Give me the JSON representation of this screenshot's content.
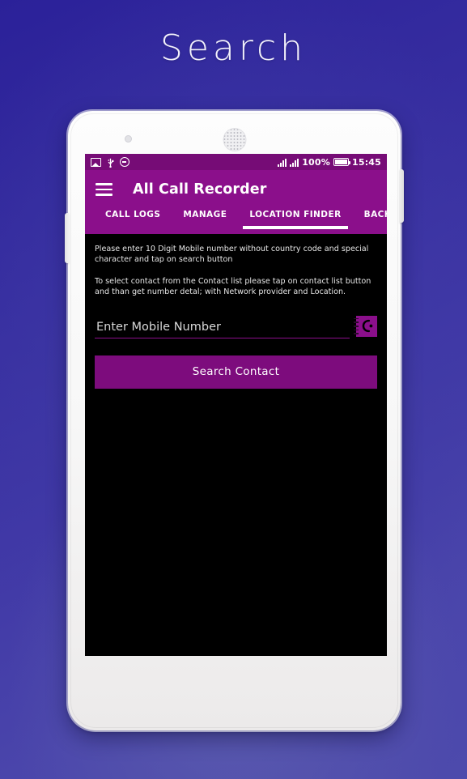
{
  "page": {
    "title": "Search"
  },
  "phone": {
    "hardware": {
      "front_camera": "front-camera",
      "earpiece": "earpiece-speaker",
      "power_button": "power-button",
      "volume_button": "volume-button"
    }
  },
  "status_bar": {
    "icons_left": [
      "photo-icon",
      "usb-icon",
      "smiley-icon"
    ],
    "icons_right": [
      "signal-icon",
      "signal-icon",
      "battery-icon"
    ],
    "battery_percent": "100%",
    "time": "15:45"
  },
  "app_bar": {
    "menu_icon": "hamburger-menu-icon",
    "title": "All Call Recorder"
  },
  "tabs": [
    {
      "label": "CALL LOGS",
      "active": false
    },
    {
      "label": "MANAGE",
      "active": false
    },
    {
      "label": "LOCATION FINDER",
      "active": true
    },
    {
      "label": "BACKUP",
      "active": false
    }
  ],
  "content": {
    "hint_1": "Please enter 10 Digit Mobile number without country code and special character and tap on search button",
    "hint_2": " To select contact from the Contact list please tap on contact list button and than get number detal; with Network provider and Location.",
    "input": {
      "placeholder": "Enter Mobile Number",
      "value": ""
    },
    "contact_book_icon": "contact-book-icon",
    "search_button_label": "Search Contact"
  },
  "colors": {
    "accent_purple": "#8b0f8b",
    "status_bar_purple": "#760c76",
    "button_purple": "#7d0c7d",
    "screen_background": "#000000",
    "page_background_start": "#2b2199",
    "page_background_end": "#4d4aac"
  }
}
